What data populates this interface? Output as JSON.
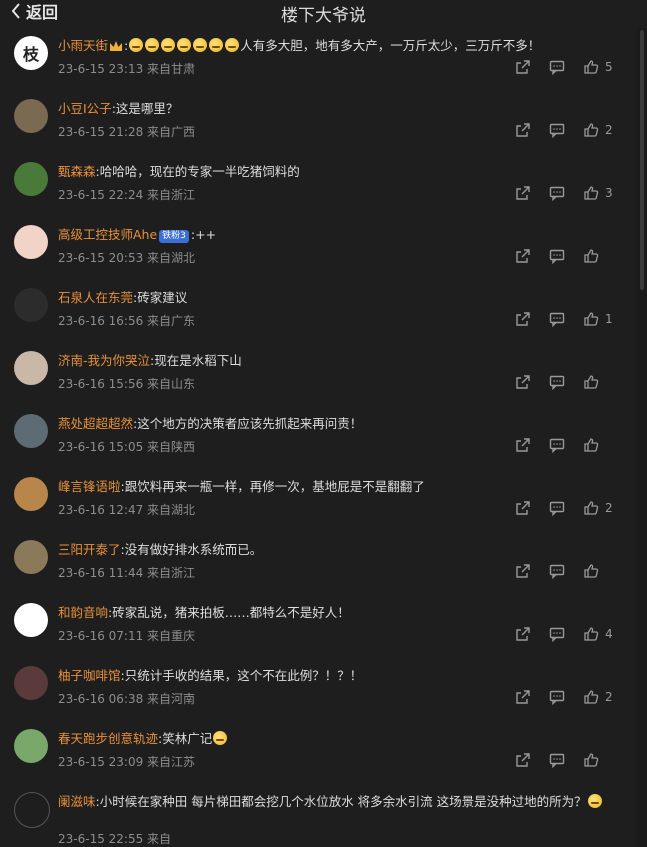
{
  "header": {
    "back_label": "返回",
    "title": "楼下大爷说"
  },
  "colors": {
    "username": "#e8913b",
    "background": "#1e1e1e",
    "meta": "#8d8d8d"
  },
  "comments": [
    {
      "user": "小雨天街",
      "text": "人有多大胆，地有多大产，一万斤太少，三万斤不多！",
      "emoji_count": 7,
      "crown": true,
      "time": "23-6-15 23:13 来自甘肃",
      "likes": "5",
      "has_share": true,
      "has_reply": true,
      "avatar_bg": "#ffffff",
      "avatar_glyph": "枝"
    },
    {
      "user": "小豆I公子",
      "text": "这是哪里？",
      "time": "23-6-15 21:28 来自广西",
      "likes": "2",
      "has_share": true,
      "has_reply": true,
      "avatar_bg": "#7a6a52",
      "avatar_glyph": ""
    },
    {
      "user": "甄森森",
      "text": "哈哈哈，现在的专家一半吃猪饲料的",
      "time": "23-6-15 22:24 来自浙江",
      "likes": "3",
      "has_share": true,
      "has_reply": true,
      "avatar_bg": "#4a7a3a",
      "avatar_glyph": ""
    },
    {
      "user": "高级工控技师Ahe",
      "badge": "铁粉3",
      "text": "++",
      "time": "23-6-15 20:53 来自湖北",
      "likes": "",
      "has_share": true,
      "has_reply": true,
      "avatar_bg": "#f2d3c8",
      "avatar_glyph": ""
    },
    {
      "user": "石泉人在东莞",
      "text": "砖家建议",
      "time": "23-6-16 16:56 来自广东",
      "likes": "1",
      "has_share": true,
      "has_reply": true,
      "avatar_bg": "#2c2c2c",
      "avatar_glyph": ""
    },
    {
      "user": "济南-我为你哭泣",
      "text": "现在是水稻下山",
      "time": "23-6-16 15:56 来自山东",
      "likes": "",
      "has_share": true,
      "has_reply": true,
      "avatar_bg": "#c9b8a8",
      "avatar_glyph": ""
    },
    {
      "user": "燕处超超超然",
      "text": "这个地方的决策者应该先抓起来再问责！",
      "time": "23-6-16 15:05 来自陕西",
      "likes": "",
      "has_share": true,
      "has_reply": true,
      "avatar_bg": "#5d6c74",
      "avatar_glyph": ""
    },
    {
      "user": "峰言锋语啦",
      "text": "跟饮料再来一瓶一样，再修一次，基地屁是不是翻翻了",
      "time": "23-6-16 12:47 来自湖北",
      "likes": "2",
      "has_share": true,
      "has_reply": true,
      "avatar_bg": "#b8864a",
      "avatar_glyph": ""
    },
    {
      "user": "三阳开泰了",
      "text": "没有做好排水系统而已。",
      "time": "23-6-16 11:44 来自浙江",
      "likes": "",
      "has_share": true,
      "has_reply": true,
      "avatar_bg": "#8a7a5a",
      "avatar_glyph": ""
    },
    {
      "user": "和韵音响",
      "text": "砖家乱说，猪来拍板……都特么不是好人！",
      "time": "23-6-16 07:11 来自重庆",
      "likes": "4",
      "has_share": true,
      "has_reply": true,
      "avatar_bg": "#ffffff",
      "avatar_glyph": ""
    },
    {
      "user": "柚子咖啡馆",
      "text": "只统计手收的结果，这个不在此例？！？！",
      "time": "23-6-16 06:38 来自河南",
      "likes": "2",
      "has_share": true,
      "has_reply": true,
      "avatar_bg": "#5a3a3a",
      "avatar_glyph": ""
    },
    {
      "user": "春天跑步创意轨迹",
      "text": "笑林广记",
      "emoji_count": 1,
      "time": "23-6-15 23:09 来自江苏",
      "likes": "",
      "has_share": true,
      "has_reply": true,
      "avatar_bg": "#7aa86a",
      "avatar_glyph": ""
    },
    {
      "user": "阑滋味",
      "text": "小时候在家种田 每片梯田都会挖几个水位放水 将多余水引流 这场景是没种过地的所为？",
      "emoji_count": 1,
      "time": "23-6-15 22:55 来自",
      "likes": "",
      "has_share": false,
      "has_reply": false,
      "avatar_bg": "#1e1e1e",
      "avatar_glyph": ""
    }
  ]
}
